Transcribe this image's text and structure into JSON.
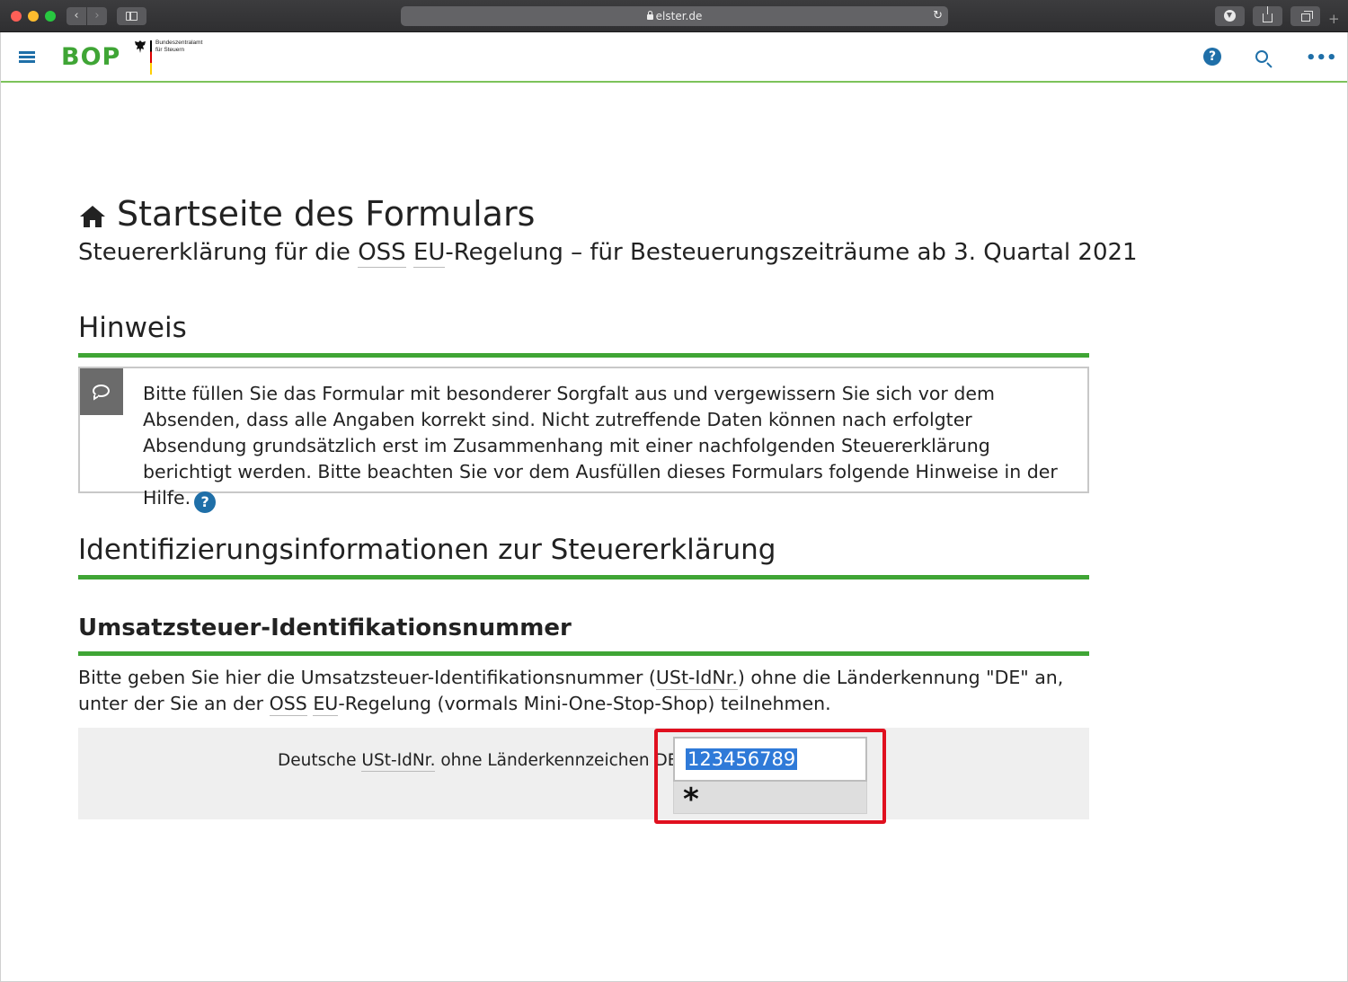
{
  "browser": {
    "url": "elster.de"
  },
  "header": {
    "logo": "BOP",
    "agency_line1": "Bundeszentralamt",
    "agency_line2": "für Steuern",
    "help_glyph": "?"
  },
  "main": {
    "title": "Startseite des Formulars",
    "subtitle_pre": "Steuererklärung für die ",
    "subtitle_oss": "OSS",
    "subtitle_eu": "EU",
    "subtitle_post": "-Regelung – für Besteuerungszeiträume ab 3. Quartal 2021",
    "hinweis_heading": "Hinweis",
    "hinweis_text": "Bitte füllen Sie das Formular mit besonderer Sorgfalt aus und vergewissern Sie sich vor dem Absenden, dass alle Angaben korrekt sind. Nicht zutreffende Daten können nach erfolgter Absendung grundsätzlich erst im Zusammenhang mit einer nachfolgenden Steuererklärung berichtigt werden. Bitte beachten Sie vor dem Ausfüllen dieses Formulars folgende Hinweise in der Hilfe.",
    "help_glyph": "?",
    "id_heading": "Identifizierungsinformationen zur Steuererklärung",
    "ust_heading": "Umsatzsteuer-Identifikationsnummer",
    "para_1": "Bitte geben Sie hier die Umsatzsteuer-Identifikationsnummer (",
    "para_ustid": "USt-IdNr.",
    "para_2": ") ohne die Länderkennung \"DE\" an, unter der Sie an der ",
    "para_oss": "OSS",
    "para_space": " ",
    "para_eu": "EU",
    "para_3": "-Regelung (vormals Mini-One-Stop-Shop) teilnehmen.",
    "field_label_pre": "Deutsche ",
    "field_label_abbr": "USt-IdNr.",
    "field_label_post": " ohne Länderkennzeichen DE",
    "field_value": "123456789",
    "required_marker": "*"
  },
  "colors": {
    "brand_green": "#3fa535",
    "link_blue": "#1f6fa8",
    "highlight_red": "#e0101f"
  }
}
